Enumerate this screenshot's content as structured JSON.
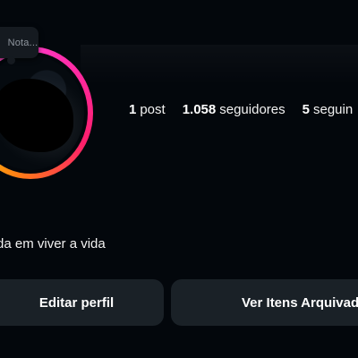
{
  "note": {
    "text": "Nota..."
  },
  "profile": {
    "stats": [
      {
        "number": "1",
        "label": "post"
      },
      {
        "number": "1.058",
        "label": "seguidores"
      },
      {
        "number": "5",
        "label": "seguin"
      }
    ],
    "bio": "da em viver a vida"
  },
  "actions": {
    "edit_profile": "Editar perfil",
    "archive": "Ver Itens Arquivado"
  },
  "colors": {
    "background": "#03070c",
    "button": "#1a2127",
    "ring_pink": "#ff2aa1",
    "ring_orange": "#ff7b16",
    "ring_yellow": "#ffc107"
  }
}
